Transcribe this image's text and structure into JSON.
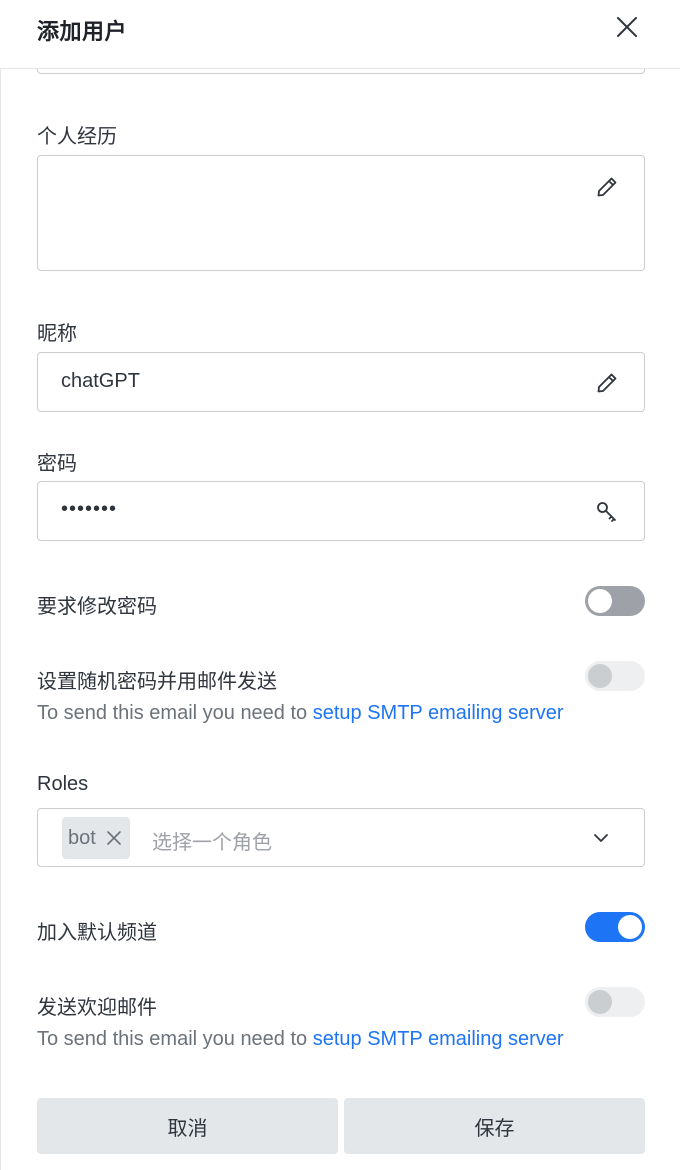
{
  "header": {
    "title": "添加用户",
    "close_icon": "close-icon"
  },
  "bio": {
    "label": "个人经历",
    "value": "",
    "icon": "pencil-icon"
  },
  "nickname": {
    "label": "昵称",
    "value": "chatGPT",
    "icon": "pencil-icon"
  },
  "password": {
    "label": "密码",
    "value": "•••••••",
    "icon": "key-icon"
  },
  "require_password_change": {
    "label": "要求修改密码",
    "enabled": false
  },
  "random_password": {
    "label": "设置随机密码并用邮件发送",
    "enabled": false,
    "disabled": true,
    "hint_prefix": "To send this email you need to ",
    "hint_link": "setup SMTP emailing server"
  },
  "roles": {
    "label": "Roles",
    "selected": [
      "bot"
    ],
    "placeholder": "选择一个角色"
  },
  "join_default_channels": {
    "label": "加入默认频道",
    "enabled": true
  },
  "send_welcome_email": {
    "label": "发送欢迎邮件",
    "enabled": false,
    "disabled": true,
    "hint_prefix": "To send this email you need to ",
    "hint_link": "setup SMTP emailing server"
  },
  "footer": {
    "cancel_label": "取消",
    "save_label": "保存"
  },
  "colors": {
    "accent": "#1d74f5",
    "toggle_off": "#9ea2a8",
    "toggle_disabled": "#eeeff1",
    "button_bg": "#e4e7ea"
  }
}
